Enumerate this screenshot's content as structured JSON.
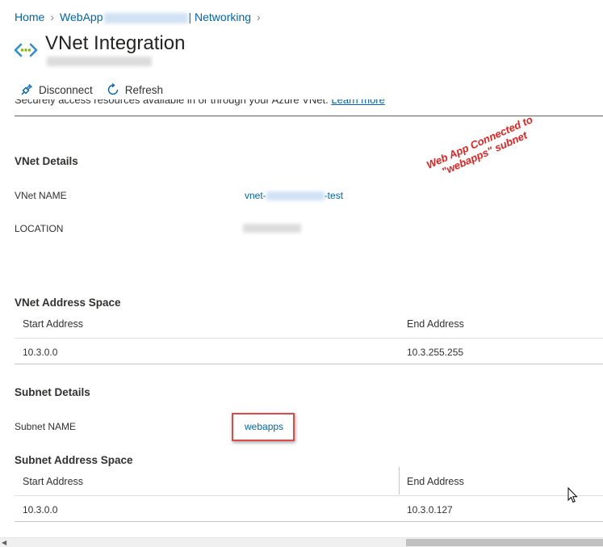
{
  "breadcrumb": {
    "home": "Home",
    "webapp": "WebApp",
    "networking": "| Networking"
  },
  "header": {
    "title": "VNet Integration"
  },
  "toolbar": {
    "disconnect_label": "Disconnect",
    "refresh_label": "Refresh"
  },
  "description": {
    "text": "Securely access resources available in or through your Azure VNet.",
    "learn_more": "Learn more"
  },
  "vnet_details": {
    "heading": "VNet Details",
    "name_label": "VNet NAME",
    "name_prefix": "vnet-",
    "name_suffix": "-test",
    "location_label": "LOCATION"
  },
  "annotation": {
    "line1": "Web App Connected to",
    "line2": "\"webapps\" subnet"
  },
  "vnet_address_space": {
    "heading": "VNet Address Space",
    "columns": [
      "Start Address",
      "End Address"
    ],
    "rows": [
      [
        "10.3.0.0",
        "10.3.255.255"
      ]
    ]
  },
  "subnet_details": {
    "heading": "Subnet Details",
    "name_label": "Subnet NAME",
    "name_value": "webapps"
  },
  "subnet_address_space": {
    "heading": "Subnet Address Space",
    "columns": [
      "Start Address",
      "End Address"
    ],
    "rows": [
      [
        "10.3.0.0",
        "10.3.0.127"
      ]
    ]
  },
  "colors": {
    "link": "#0064b4",
    "annotation": "#e8201e",
    "highlight_border": "#e0494a"
  },
  "icons": [
    "chevron-right-icon",
    "vnet-icon",
    "disconnect-plug-icon",
    "refresh-icon",
    "mouse-pointer-icon"
  ]
}
